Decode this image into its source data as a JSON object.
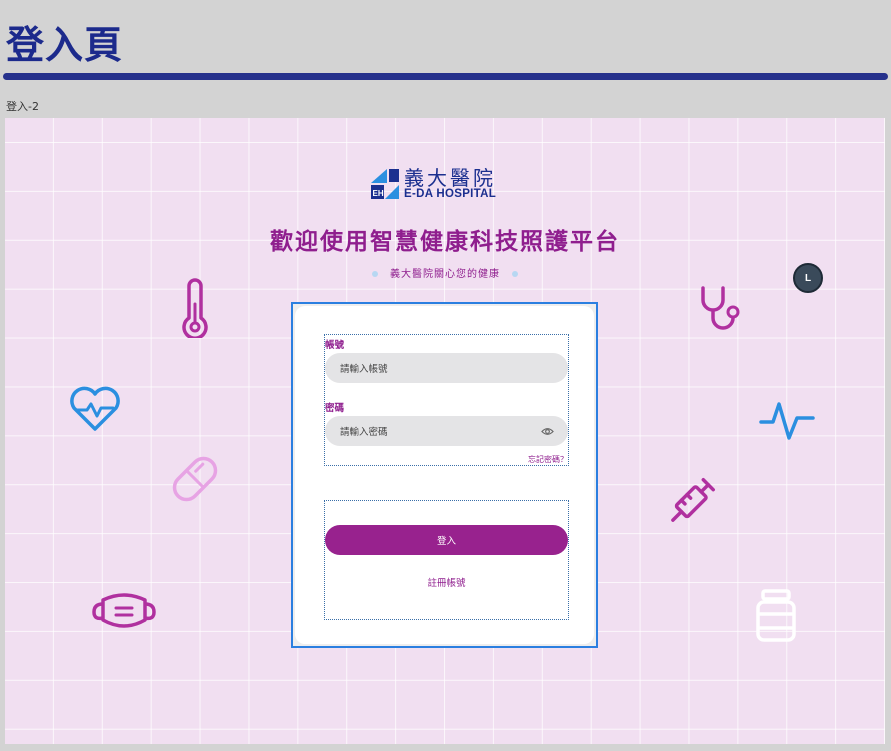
{
  "page": {
    "title": "登入頁",
    "frame_label": "登入-2"
  },
  "brand": {
    "name_zh": "義大醫院",
    "name_en": "E-DA HOSPITAL"
  },
  "hero": {
    "welcome": "歡迎使用智慧健康科技照護平台",
    "subtitle": "義大醫院關心您的健康"
  },
  "user_badge": "L",
  "form": {
    "account_label": "帳號",
    "account_placeholder": "請輸入帳號",
    "password_label": "密碼",
    "password_placeholder": "請輸入密碼",
    "forgot_password": "忘記密碼？",
    "login_button": "登入",
    "register_link": "註冊帳號"
  },
  "colors": {
    "brand_purple": "#98228e",
    "brand_navy": "#1c2a8c",
    "background_pink": "#f1dff1",
    "icon_blue": "#2b8fe0"
  },
  "decorative_icons": [
    "thermometer-icon",
    "heartbeat-icon",
    "pill-icon",
    "face-mask-icon",
    "stethoscope-icon",
    "pulse-icon",
    "syringe-icon",
    "medicine-jar-icon"
  ]
}
